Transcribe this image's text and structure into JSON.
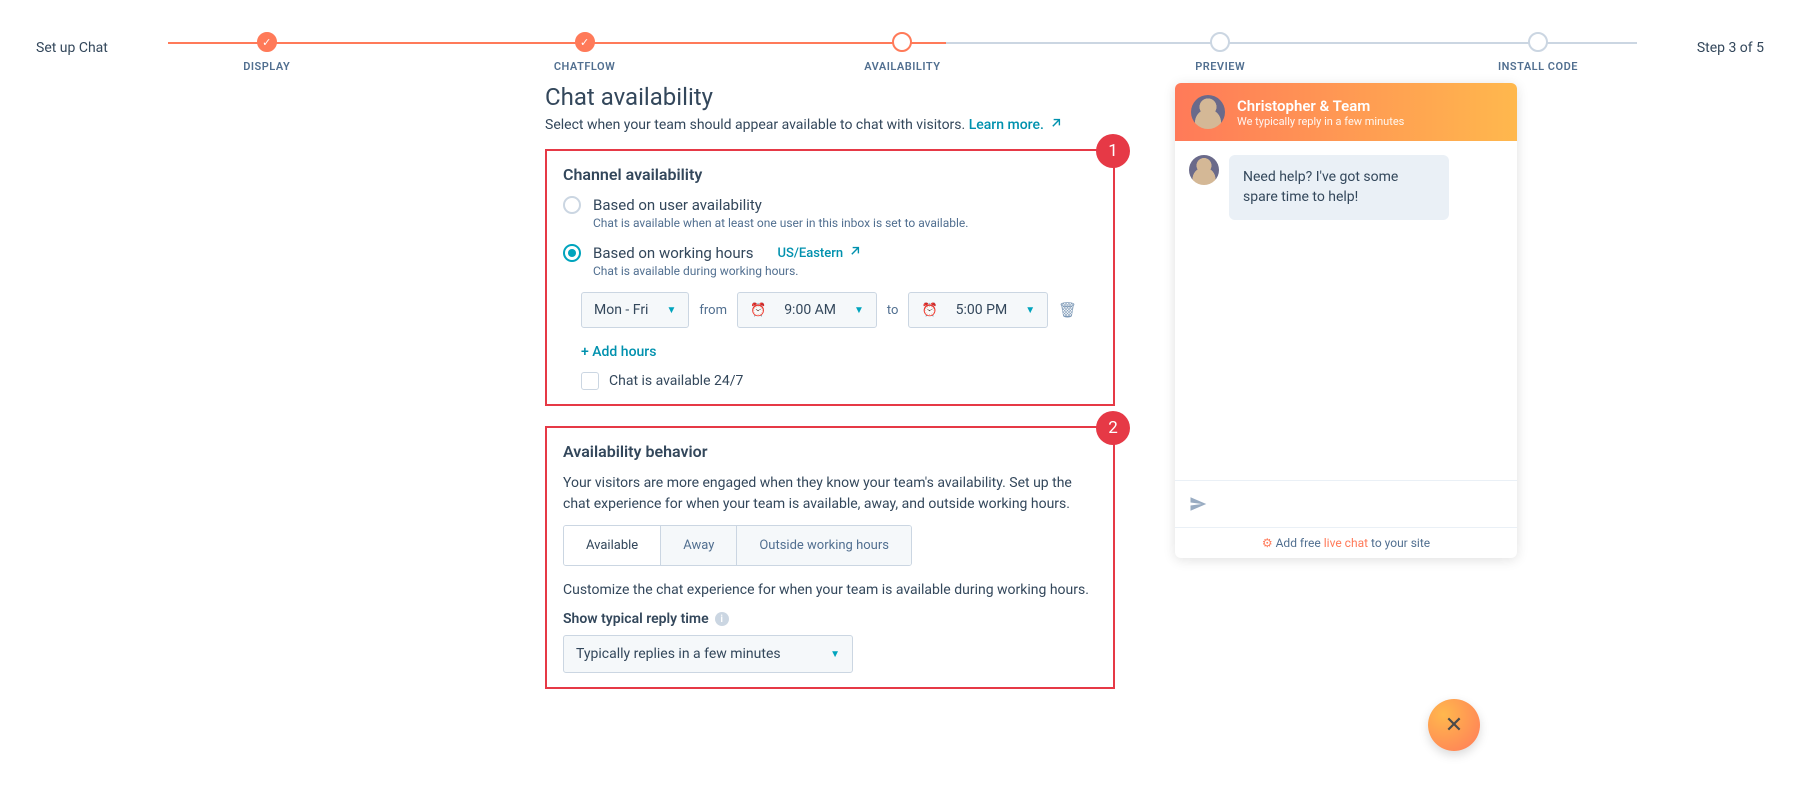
{
  "header": {
    "title": "Set up Chat",
    "step_indicator": "Step 3 of 5",
    "steps": [
      "DISPLAY",
      "CHATFLOW",
      "AVAILABILITY",
      "PREVIEW",
      "INSTALL CODE"
    ]
  },
  "page": {
    "heading": "Chat availability",
    "sub": "Select when your team should appear available to chat with visitors.",
    "learn_more": "Learn more."
  },
  "annot": {
    "one": "1",
    "two": "2"
  },
  "channel": {
    "heading": "Channel availability",
    "opt1": {
      "label": "Based on user availability",
      "hint": "Chat is available when at least one user in this inbox is set to available."
    },
    "opt2": {
      "label": "Based on working hours",
      "hint": "Chat is available during working hours.",
      "tz": "US/Eastern"
    },
    "days": "Mon - Fri",
    "from": "from",
    "start": "9:00 AM",
    "to": "to",
    "end": "5:00 PM",
    "add": "+ Add hours",
    "always": "Chat is available 24/7"
  },
  "behavior": {
    "heading": "Availability behavior",
    "body": "Your visitors are more engaged when they know your team's availability. Set up the chat experience for when your team is available, away, and outside working hours.",
    "tabs": [
      "Available",
      "Away",
      "Outside working hours"
    ],
    "avail_desc": "Customize the chat experience for when your team is available during working hours.",
    "reply_label": "Show typical reply time",
    "reply_value": "Typically replies in a few minutes"
  },
  "chat": {
    "name": "Christopher & Team",
    "sub": "We typically reply in a few minutes",
    "msg": "Need help? I've got some spare time to help!",
    "foot_pre": "Add free ",
    "foot_link": "live chat",
    "foot_post": " to your site"
  }
}
